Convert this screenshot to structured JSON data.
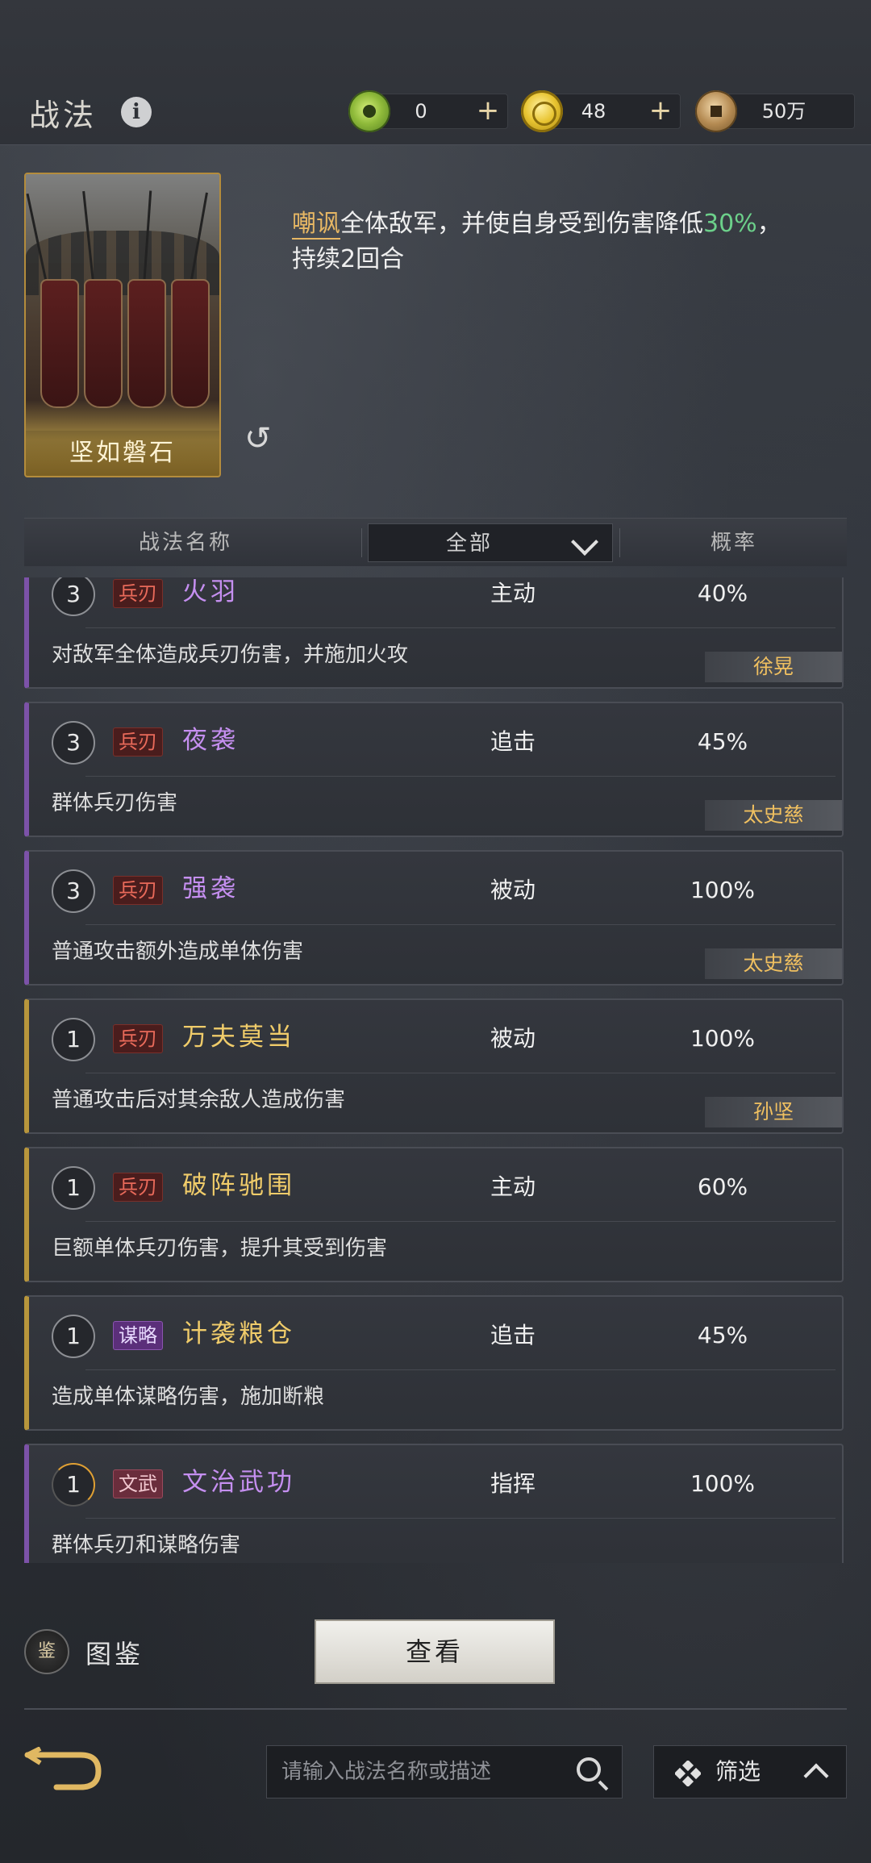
{
  "header": {
    "title": "战法",
    "resources": [
      {
        "icon": "jade-coin-icon",
        "value": "0"
      },
      {
        "icon": "gold-coin-icon",
        "value": "48"
      },
      {
        "icon": "copper-coin-icon",
        "value": "50万"
      }
    ],
    "plus": "+"
  },
  "featured": {
    "card_name": "坚如磐石",
    "desc_keyword": "嘲讽",
    "desc_text1": "全体敌军，并使自身受到伤害降低",
    "desc_num": "30%",
    "desc_text2": "，持续2回合"
  },
  "table_header": {
    "col_name": "战法名称",
    "filter_value": "全部",
    "col_rate": "概率"
  },
  "skills": [
    {
      "level": "3",
      "tag": "兵刃",
      "tag_type": "blade",
      "name": "火羽",
      "quality": "purple",
      "type": "主动",
      "rate": "40%",
      "desc": "对敌军全体造成兵刃伤害，并施加火攻",
      "hero": "徐晃"
    },
    {
      "level": "3",
      "tag": "兵刃",
      "tag_type": "blade",
      "name": "夜袭",
      "quality": "purple",
      "type": "追击",
      "rate": "45%",
      "desc": "群体兵刃伤害",
      "hero": "太史慈"
    },
    {
      "level": "3",
      "tag": "兵刃",
      "tag_type": "blade",
      "name": "强袭",
      "quality": "purple",
      "type": "被动",
      "rate": "100%",
      "desc": "普通攻击额外造成单体伤害",
      "hero": "太史慈"
    },
    {
      "level": "1",
      "tag": "兵刃",
      "tag_type": "blade",
      "name": "万夫莫当",
      "quality": "gold",
      "type": "被动",
      "rate": "100%",
      "desc": "普通攻击后对其余敌人造成伤害",
      "hero": "孙坚"
    },
    {
      "level": "1",
      "tag": "兵刃",
      "tag_type": "blade",
      "name": "破阵驰围",
      "quality": "gold",
      "type": "主动",
      "rate": "60%",
      "desc": "巨额单体兵刃伤害，提升其受到伤害",
      "hero": ""
    },
    {
      "level": "1",
      "tag": "谋略",
      "tag_type": "scheme",
      "name": "计袭粮仓",
      "quality": "gold",
      "type": "追击",
      "rate": "45%",
      "desc": "造成单体谋略伤害，施加断粮",
      "hero": ""
    },
    {
      "level": "1",
      "tag": "文武",
      "tag_type": "wenwu",
      "name": "文治武功",
      "quality": "purple",
      "type": "指挥",
      "rate": "100%",
      "desc": "群体兵刃和谋略伤害",
      "hero": ""
    }
  ],
  "bottom": {
    "atlas_label": "图鉴",
    "atlas_icon_char": "鉴",
    "view_button": "查看",
    "search_placeholder": "请输入战法名称或描述",
    "filter_label": "筛选"
  }
}
